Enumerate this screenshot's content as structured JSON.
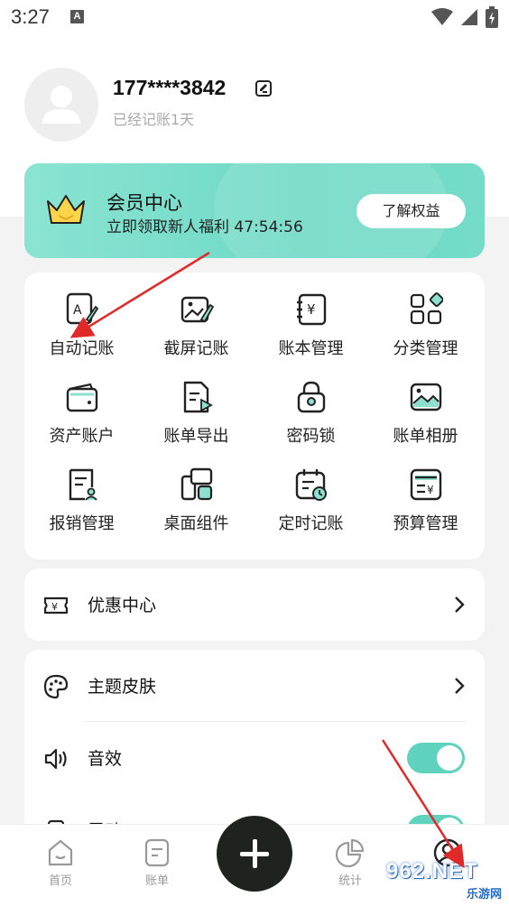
{
  "status_bar": {
    "time": "3:27",
    "a_badge": "A"
  },
  "profile": {
    "phone": "177****3842",
    "days_text": "已经记账1天"
  },
  "vip": {
    "title": "会员中心",
    "subtitle": "立即领取新人福利 47:54:56",
    "button": "了解权益"
  },
  "grid": [
    {
      "label": "自动记账",
      "icon": "auto-record-icon"
    },
    {
      "label": "截屏记账",
      "icon": "screenshot-record-icon"
    },
    {
      "label": "账本管理",
      "icon": "ledger-icon"
    },
    {
      "label": "分类管理",
      "icon": "category-icon"
    },
    {
      "label": "资产账户",
      "icon": "wallet-icon"
    },
    {
      "label": "账单导出",
      "icon": "export-icon"
    },
    {
      "label": "密码锁",
      "icon": "lock-icon"
    },
    {
      "label": "账单相册",
      "icon": "album-icon"
    },
    {
      "label": "报销管理",
      "icon": "reimburse-icon"
    },
    {
      "label": "桌面组件",
      "icon": "widget-icon"
    },
    {
      "label": "定时记账",
      "icon": "timer-record-icon"
    },
    {
      "label": "预算管理",
      "icon": "budget-icon"
    }
  ],
  "coupon": {
    "label": "优惠中心"
  },
  "settings": {
    "theme": "主题皮肤",
    "sound": "音效",
    "vibrate": "震动"
  },
  "nav": [
    {
      "label": "首页"
    },
    {
      "label": "账单"
    },
    {
      "label": "统计"
    },
    {
      "label": ""
    }
  ],
  "watermark": {
    "brand": "962.NET",
    "site": "乐游网"
  },
  "colors": {
    "accent": "#5fd3bd",
    "vip_bg": "#7adcc9",
    "fab": "#1e2320",
    "arrow": "#e02a2a"
  }
}
